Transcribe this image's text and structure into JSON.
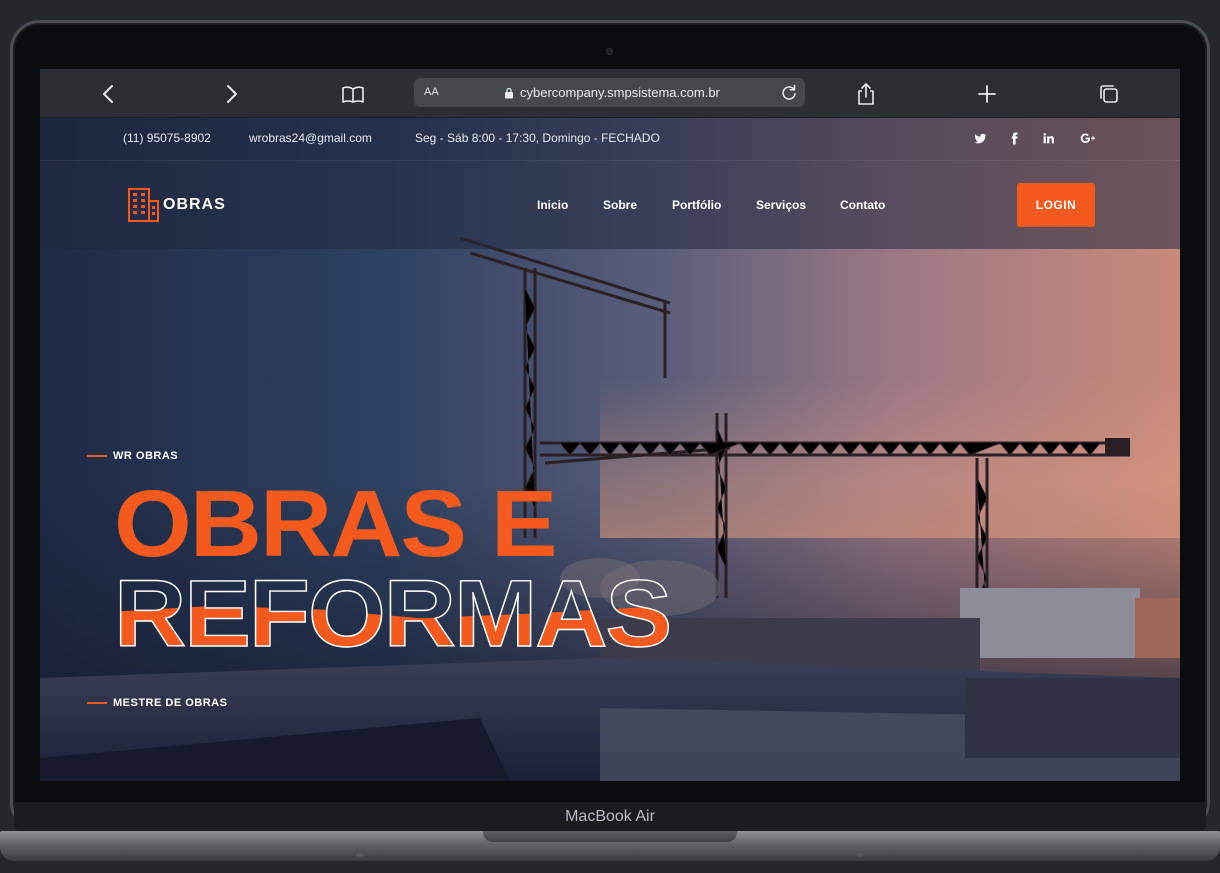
{
  "device": {
    "label": "MacBook Air"
  },
  "browser": {
    "text_size_label": "AA",
    "url": "cybercompany.smpsistema.com.br"
  },
  "topbar": {
    "phone": "(11) 95075-8902",
    "email": "wrobras24@gmail.com",
    "hours": "Seg - Sáb 8:00 - 17:30, Domingo - FECHADO",
    "social": [
      "twitter-icon",
      "facebook-icon",
      "linkedin-icon",
      "google-plus-icon"
    ]
  },
  "nav": {
    "logo_text": "OBRAS",
    "links": [
      "Inicio",
      "Sobre",
      "Portfólio",
      "Serviços",
      "Contato"
    ],
    "login_label": "LOGIN"
  },
  "hero": {
    "eyebrow_top": "WR OBRAS",
    "title_line1": "OBRAS E",
    "title_line2": "REFORMAS",
    "eyebrow_bottom": "MESTRE DE OBRAS"
  },
  "colors": {
    "accent": "#f4591d",
    "page_background": "#23282b",
    "browser_bar": "#2b2f33"
  }
}
